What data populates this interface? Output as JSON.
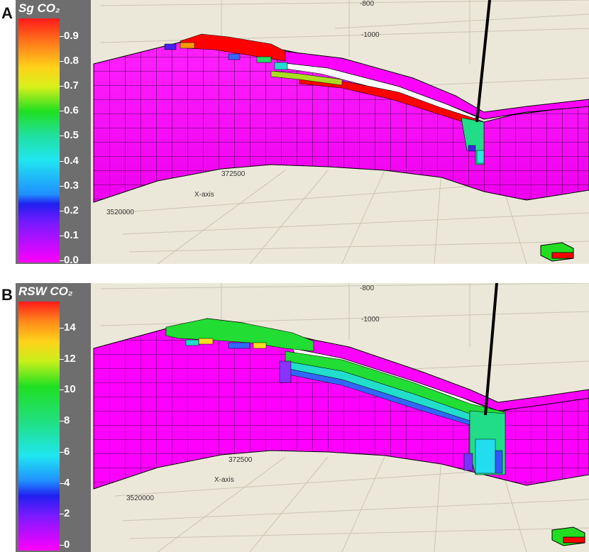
{
  "panels": [
    {
      "letter": "A",
      "legend_title": "Sg CO₂",
      "ticks": [
        "0.9",
        "0.8",
        "0.7",
        "0.6",
        "0.5",
        "0.4",
        "0.3",
        "0.2",
        "0.1",
        "0.0"
      ],
      "axis_top": "-800",
      "axis_depth": "-1000",
      "axis_x_label": "X-axis",
      "axis_x_tick": "372500",
      "axis_y_tick": "3520000"
    },
    {
      "letter": "B",
      "legend_title": "RSW CO₂",
      "ticks": [
        "14",
        "12",
        "10",
        "8",
        "6",
        "4",
        "2",
        "0"
      ],
      "axis_top": "-800",
      "axis_depth": "-1000",
      "axis_x_label": "X-axis",
      "axis_x_tick": "372500",
      "axis_y_tick": "3520000"
    }
  ],
  "colors": {
    "background": "#ece8d9",
    "legend_bg": "#6e6e6e",
    "reservoir": "#ff00ff",
    "plume_high": "#ff0000",
    "plume_mid": "#22dd22",
    "plume_low": "#22dddd"
  }
}
